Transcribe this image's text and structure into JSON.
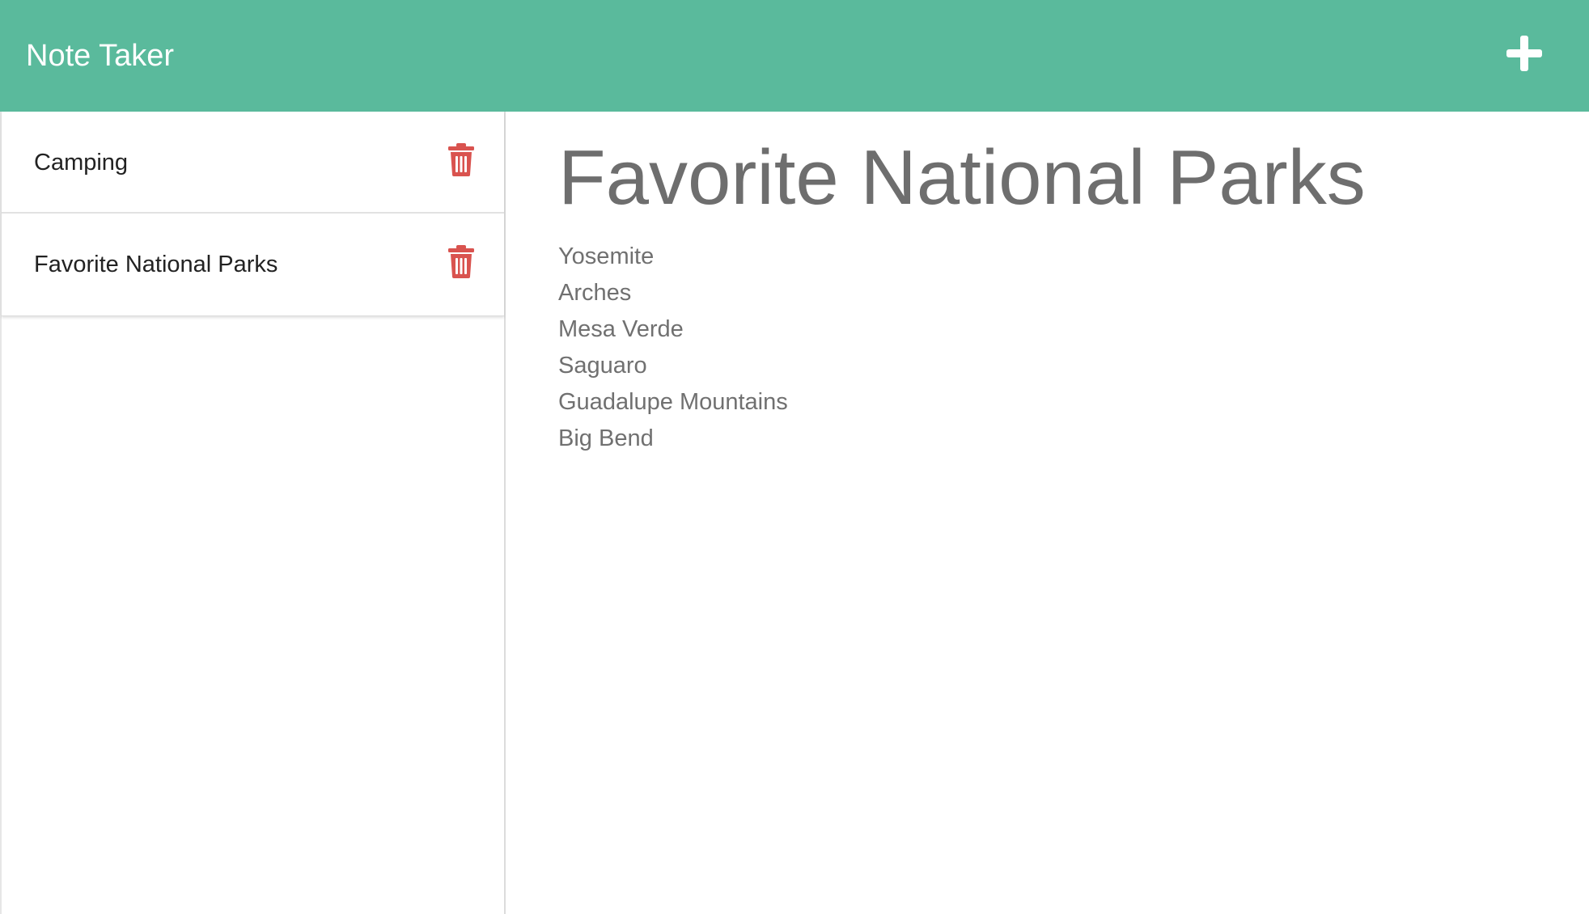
{
  "app": {
    "title": "Note Taker",
    "accent_color": "#5aba9c",
    "new_note_icon": "plus-icon"
  },
  "sidebar": {
    "notes": [
      {
        "title": "Camping",
        "delete_icon": "trash-icon"
      },
      {
        "title": "Favorite National Parks",
        "delete_icon": "trash-icon"
      }
    ],
    "delete_color": "#d9534f"
  },
  "main": {
    "note_title": "Favorite National Parks",
    "note_lines": [
      "Yosemite",
      "Arches",
      "Mesa Verde",
      "Saguaro",
      "Guadalupe Mountains",
      "Big Bend"
    ]
  }
}
